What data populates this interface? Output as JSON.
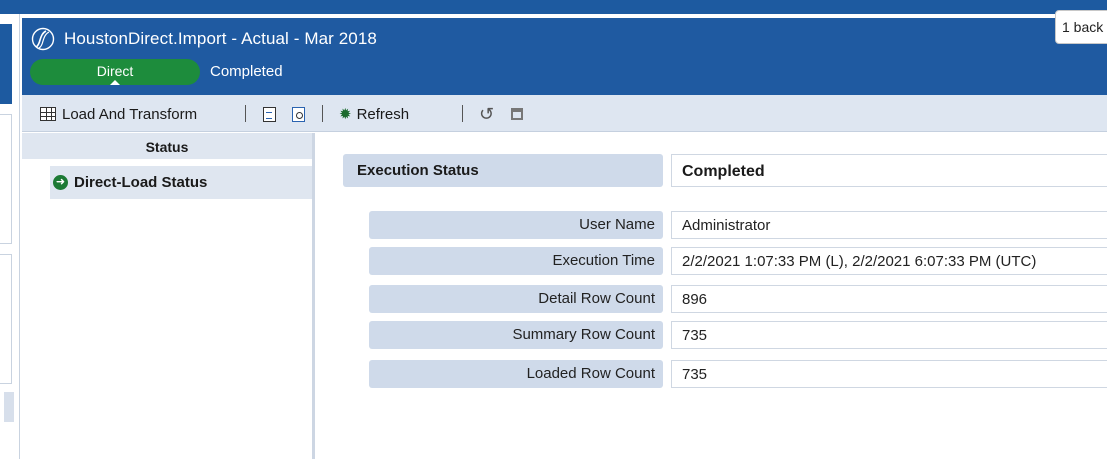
{
  "window": {
    "title": "HoustonDirect.Import  -  Actual  -  Mar 2018",
    "workflow_pill": "Direct",
    "workflow_status": "Completed",
    "tooltip": "1 back"
  },
  "toolbar": {
    "load_transform_label": "Load And Transform",
    "refresh_label": "Refresh"
  },
  "left_panel": {
    "header": "Status",
    "items": [
      {
        "label": "Direct-Load Status",
        "selected": true
      }
    ]
  },
  "status": {
    "execution_label": "Execution Status",
    "execution_value": "Completed",
    "rows": [
      {
        "label": "User Name",
        "value": "Administrator"
      },
      {
        "label": "Execution Time",
        "value": "2/2/2021 1:07:33 PM (L), 2/2/2021 6:07:33 PM (UTC)"
      },
      {
        "label": "Detail Row Count",
        "value": "896"
      },
      {
        "label": "Summary Row Count",
        "value": "735"
      },
      {
        "label": "Loaded Row Count",
        "value": "735"
      }
    ]
  },
  "colors": {
    "header_blue": "#1f5aa1",
    "pill_green": "#1d8c3c",
    "label_bg": "#cfdaea"
  }
}
